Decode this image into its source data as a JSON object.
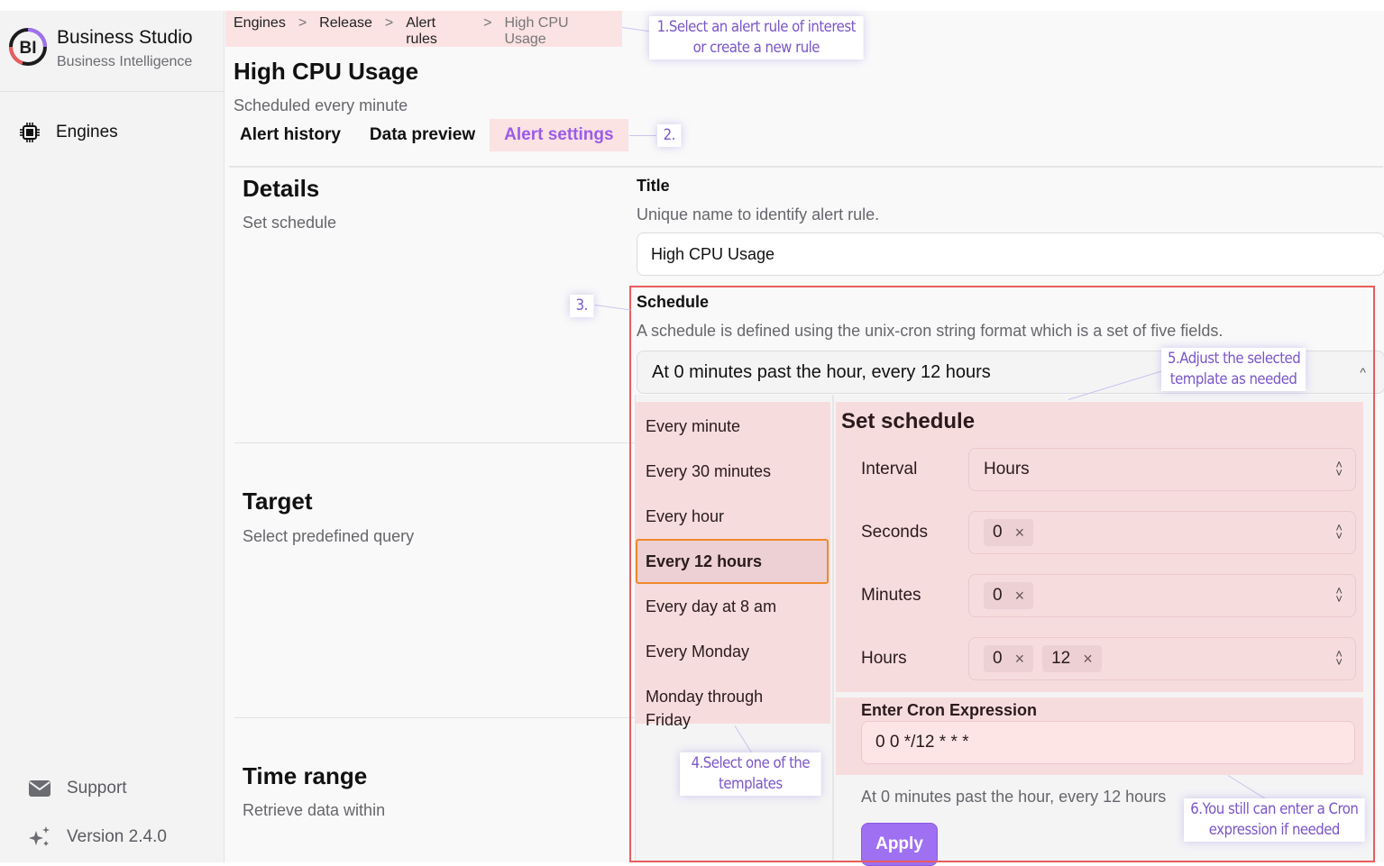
{
  "app": {
    "brand_name": "Business Studio",
    "brand_subtitle": "Business Intelligence",
    "logo_text": "BI",
    "accent_color": "#a070f2",
    "highlight_color": "#fbe2e3"
  },
  "sidebar": {
    "items": [
      {
        "label": "Engines",
        "icon": "cpu-chip-icon"
      }
    ],
    "footer": [
      {
        "label": "Support",
        "icon": "envelope-icon"
      },
      {
        "label": "Version 2.4.0",
        "icon": "sparkles-icon"
      }
    ]
  },
  "breadcrumb": {
    "items": [
      "Engines",
      "Release",
      "Alert rules",
      "High CPU Usage"
    ],
    "separator": ">"
  },
  "header": {
    "title": "High CPU Usage",
    "subtitle": "Scheduled every minute",
    "tabs": [
      {
        "label": "Alert history",
        "active": false
      },
      {
        "label": "Data preview",
        "active": false
      },
      {
        "label": "Alert settings",
        "active": true
      }
    ]
  },
  "sections": {
    "details": {
      "title": "Details",
      "subtitle": "Set schedule"
    },
    "target": {
      "title": "Target",
      "subtitle": "Select predefined query"
    },
    "time_range": {
      "title": "Time range",
      "subtitle": "Retrieve data within"
    }
  },
  "form": {
    "title_field": {
      "label": "Title",
      "help": "Unique name to identify alert rule.",
      "value": "High CPU Usage"
    },
    "schedule": {
      "label": "Schedule",
      "help": "A schedule is defined using the unix-cron string format which is a set of five fields.",
      "selected_summary": "At 0 minutes past the hour, every 12 hours",
      "chevron": "^",
      "templates": [
        {
          "label": "Every minute",
          "selected": false
        },
        {
          "label": "Every 30 minutes",
          "selected": false
        },
        {
          "label": "Every hour",
          "selected": false
        },
        {
          "label": "Every 12 hours",
          "selected": true
        },
        {
          "label": "Every day at 8 am",
          "selected": false
        },
        {
          "label": "Every Monday",
          "selected": false
        },
        {
          "label": "Monday through Friday",
          "selected": false
        }
      ],
      "set_schedule": {
        "heading": "Set schedule",
        "interval": {
          "label": "Interval",
          "value": "Hours"
        },
        "seconds": {
          "label": "Seconds",
          "chips": [
            "0"
          ]
        },
        "minutes": {
          "label": "Minutes",
          "chips": [
            "0"
          ]
        },
        "hours": {
          "label": "Hours",
          "chips": [
            "0",
            "12"
          ]
        },
        "chip_remove_glyph": "×",
        "updown_glyph_up": "˄",
        "updown_glyph_down": "˅"
      },
      "cron": {
        "label": "Enter Cron Expression",
        "value": "0 0 */12 * * *",
        "description": "At 0 minutes past the hour, every 12 hours"
      },
      "apply_label": "Apply"
    }
  },
  "annotations": [
    {
      "id": "1",
      "text_line1": "1.Select an alert rule of interest",
      "text_line2": "or create a new rule"
    },
    {
      "id": "2",
      "text_line1": "2.",
      "text_line2": ""
    },
    {
      "id": "3",
      "text_line1": "3.",
      "text_line2": ""
    },
    {
      "id": "4",
      "text_line1": "4.Select one of the",
      "text_line2": "templates"
    },
    {
      "id": "5",
      "text_line1": "5.Adjust the selected",
      "text_line2": "template as needed"
    },
    {
      "id": "6",
      "text_line1": "6.You still can enter a Cron",
      "text_line2": "expression if needed"
    }
  ]
}
